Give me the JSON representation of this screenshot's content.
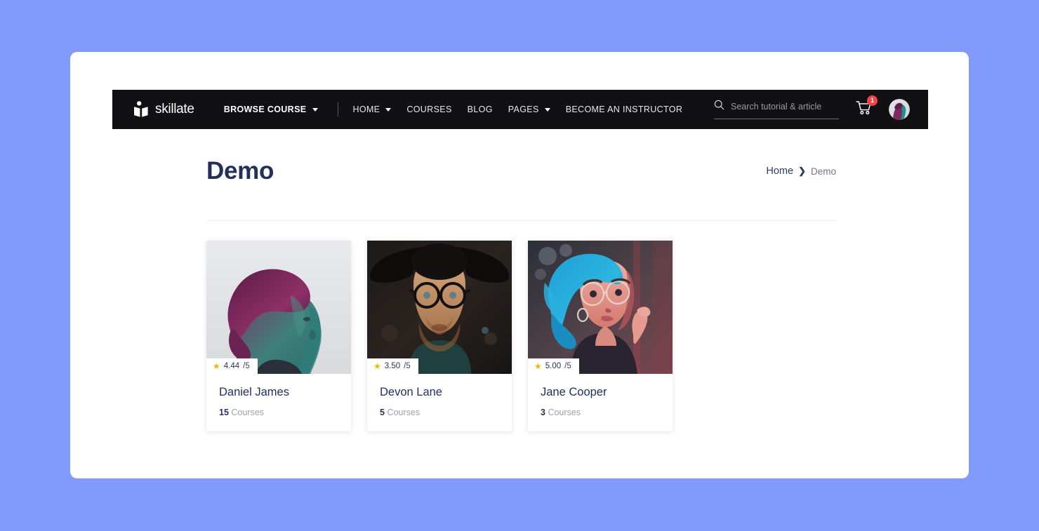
{
  "theme": {
    "page_background": "#829bfa",
    "card_background": "#ffffff",
    "navbar_background": "#111114",
    "title_color": "#22305c",
    "badge_color": "#f2434a",
    "star_color": "#f7b500"
  },
  "navbar": {
    "brand": {
      "name": "skillate",
      "icon": "open-book-icon"
    },
    "browse": {
      "label": "BROWSE COURSE",
      "icon": "chevron-down-icon"
    },
    "links": [
      {
        "label": "HOME",
        "has_dropdown": true
      },
      {
        "label": "COURSES",
        "has_dropdown": false
      },
      {
        "label": "BLOG",
        "has_dropdown": false
      },
      {
        "label": "PAGES",
        "has_dropdown": true
      },
      {
        "label": "BECOME AN INSTRUCTOR",
        "has_dropdown": false
      }
    ],
    "search": {
      "placeholder": "Search tutorial & article",
      "value": "",
      "icon": "search-icon"
    },
    "cart": {
      "icon": "shopping-cart-icon",
      "badge_count": "1"
    },
    "avatar": {
      "icon": "user-avatar"
    }
  },
  "header": {
    "title": "Demo",
    "breadcrumb": {
      "home": "Home",
      "separator": "❯",
      "current": "Demo"
    }
  },
  "instructors": [
    {
      "name": "Daniel James",
      "rating": "4.44",
      "rating_out_of": "/5",
      "course_count": "15",
      "course_label": "Courses",
      "photo": "portrait-magenta-teal"
    },
    {
      "name": "Devon Lane",
      "rating": "3.50",
      "rating_out_of": "/5",
      "course_count": "5",
      "course_label": "Courses",
      "photo": "portrait-man-hat-glasses"
    },
    {
      "name": "Jane Cooper",
      "rating": "5.00",
      "rating_out_of": "/5",
      "course_count": "3",
      "course_label": "Courses",
      "photo": "portrait-blue-hair"
    }
  ]
}
